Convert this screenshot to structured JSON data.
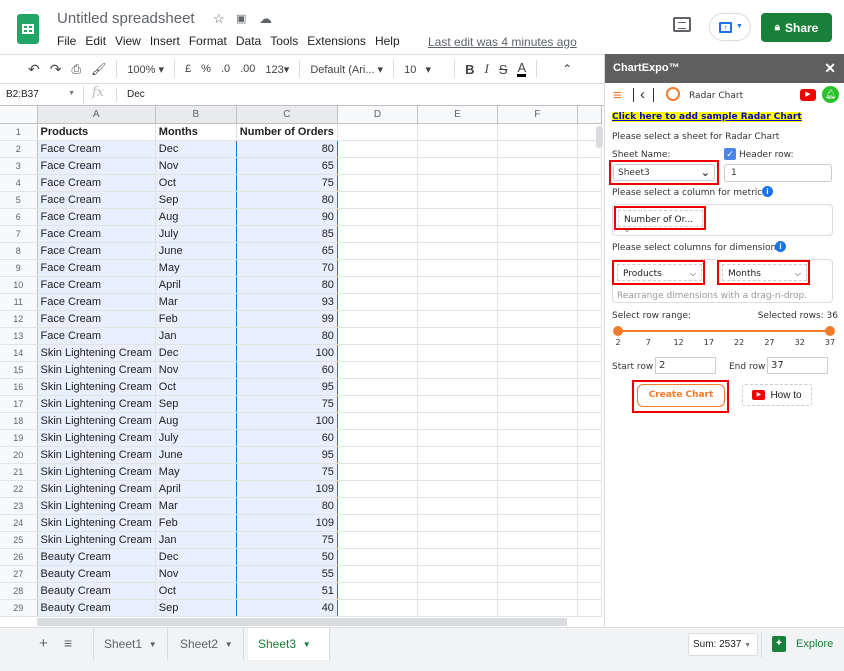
{
  "app": {
    "doc_title": "Untitled spreadsheet",
    "menu": [
      "File",
      "Edit",
      "View",
      "Insert",
      "Format",
      "Data",
      "Tools",
      "Extensions",
      "Help"
    ],
    "last_edit": "Last edit was 4 minutes ago",
    "share_label": "Share"
  },
  "toolbar": {
    "zoom": "100%",
    "currency": "£",
    "percent": "%",
    "dec_decrease": ".0",
    "dec_increase": ".00",
    "format_123": "123",
    "font": "Default (Ari...",
    "font_size": "10",
    "bold": "B",
    "italic": "I",
    "strike": "S",
    "text_color": "A"
  },
  "formula_bar": {
    "name_box": "B2:B37",
    "fx": "fx",
    "value": "Dec"
  },
  "grid": {
    "columns": [
      "A",
      "B",
      "C",
      "D",
      "E",
      "F"
    ],
    "header_row": [
      "Products",
      "Months",
      "Number of Orders"
    ],
    "rows": [
      [
        "Face Cream",
        "Dec",
        "80"
      ],
      [
        "Face Cream",
        "Nov",
        "65"
      ],
      [
        "Face Cream",
        "Oct",
        "75"
      ],
      [
        "Face Cream",
        "Sep",
        "80"
      ],
      [
        "Face Cream",
        "Aug",
        "90"
      ],
      [
        "Face Cream",
        "July",
        "85"
      ],
      [
        "Face Cream",
        "June",
        "65"
      ],
      [
        "Face Cream",
        "May",
        "70"
      ],
      [
        "Face Cream",
        "April",
        "80"
      ],
      [
        "Face Cream",
        "Mar",
        "93"
      ],
      [
        "Face Cream",
        "Feb",
        "99"
      ],
      [
        "Face Cream",
        "Jan",
        "80"
      ],
      [
        "Skin Lightening Cream",
        "Dec",
        "100"
      ],
      [
        "Skin Lightening Cream",
        "Nov",
        "60"
      ],
      [
        "Skin Lightening Cream",
        "Oct",
        "95"
      ],
      [
        "Skin Lightening Cream",
        "Sep",
        "75"
      ],
      [
        "Skin Lightening Cream",
        "Aug",
        "100"
      ],
      [
        "Skin Lightening Cream",
        "July",
        "60"
      ],
      [
        "Skin Lightening Cream",
        "June",
        "95"
      ],
      [
        "Skin Lightening Cream",
        "May",
        "75"
      ],
      [
        "Skin Lightening Cream",
        "April",
        "109"
      ],
      [
        "Skin Lightening Cream",
        "Mar",
        "80"
      ],
      [
        "Skin Lightening Cream",
        "Feb",
        "109"
      ],
      [
        "Skin Lightening Cream",
        "Jan",
        "75"
      ],
      [
        "Beauty Cream",
        "Dec",
        "50"
      ],
      [
        "Beauty Cream",
        "Nov",
        "55"
      ],
      [
        "Beauty Cream",
        "Oct",
        "51"
      ],
      [
        "Beauty Cream",
        "Sep",
        "40"
      ]
    ]
  },
  "bottom": {
    "sheets": [
      "Sheet1",
      "Sheet2",
      "Sheet3"
    ],
    "active_sheet": "Sheet3",
    "sum": "Sum: 2537",
    "explore": "Explore"
  },
  "panel": {
    "title": "ChartExpo™",
    "chart_name": "Radar Chart",
    "sample_link": "Click here to add sample Radar Chart",
    "select_sheet_text": "Please select a sheet for Radar Chart",
    "sheet_name_label": "Sheet Name:",
    "sheet_name_value": "Sheet3",
    "header_row_label": "Header row:",
    "header_row_checked": true,
    "header_row_value": "1",
    "metric_label": "Please select a column for metric:",
    "metric_value": "Number of Or...",
    "dimension_label": "Please select columns for dimension:",
    "dimension_values": [
      "Products",
      "Months"
    ],
    "drag_hint": "Rearrange dimensions with a drag-n-drop.",
    "row_range_label": "Select row range:",
    "selected_rows": "Selected rows: 36",
    "range_ticks": [
      "2",
      "7",
      "12",
      "17",
      "22",
      "27",
      "32",
      "37"
    ],
    "range_start": 2,
    "range_end": 37,
    "start_row_label": "Start row",
    "start_row_value": "2",
    "end_row_label": "End row",
    "end_row_value": "37",
    "create_chart": "Create Chart",
    "how_to": "How to",
    "accent_color": "#f07c2c"
  }
}
